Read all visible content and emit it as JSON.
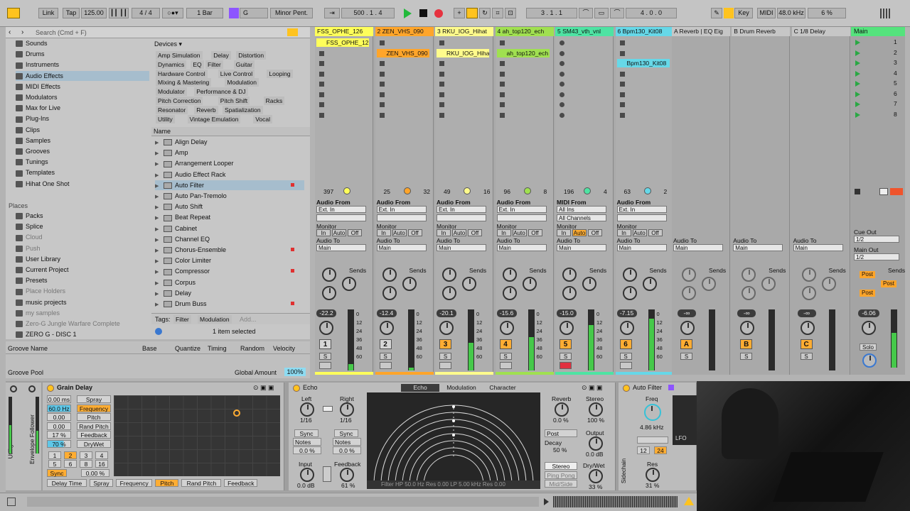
{
  "transport": {
    "link": "Link",
    "tap": "Tap",
    "tempo": "125.00",
    "sig_num": "4",
    "sig_den": "4",
    "quant": "1 Bar",
    "key_root": "G",
    "scale": "Minor Pent.",
    "arr_pos": "500 . 1 . 4",
    "punch_start": "3 . 1 . 1",
    "punch_len": "4 . 0 . 0",
    "key_label": "Key",
    "midi_label": "MIDI",
    "sample_rate": "48.0 kHz",
    "cpu": "6 %"
  },
  "browser": {
    "search_placeholder": "Search (Cmd + F)",
    "categories": [
      "Sounds",
      "Drums",
      "Instruments",
      "Audio Effects",
      "MIDI Effects",
      "Modulators",
      "Max for Live",
      "Plug-Ins",
      "Clips",
      "Samples",
      "Grooves",
      "Tunings",
      "Templates",
      "Hihat One Shot"
    ],
    "places_label": "Places",
    "places": [
      "Packs",
      "Splice",
      "Cloud",
      "Push",
      "User Library",
      "Current Project",
      "Presets",
      "Place Holders",
      "music projects",
      "my samples",
      "Zero-G Jungle Warfare Complete",
      "ZERO G - DISC 1"
    ],
    "devices_label": "Devices",
    "tags": [
      [
        "Amp Simulation",
        "Delay",
        "Distortion"
      ],
      [
        "Dynamics",
        "EQ",
        "Filter",
        "Guitar"
      ],
      [
        "Hardware Control",
        "Live Control",
        "Looping"
      ],
      [
        "Mixing & Mastering",
        "Modulation"
      ],
      [
        "Modulator",
        "Performance & DJ"
      ],
      [
        "Pitch Correction",
        "Pitch Shift",
        "Racks"
      ],
      [
        "Resonator",
        "Reverb",
        "Spatialization"
      ],
      [
        "Utility",
        "Vintage Emulation",
        "Vocal"
      ]
    ],
    "name_header": "Name",
    "items": [
      "Align Delay",
      "Amp",
      "Arrangement Looper",
      "Audio Effect Rack",
      "Auto Filter",
      "Auto Pan-Tremolo",
      "Auto Shift",
      "Beat Repeat",
      "Cabinet",
      "Channel EQ",
      "Chorus-Ensemble",
      "Color Limiter",
      "Compressor",
      "Corpus",
      "Delay",
      "Drum Buss"
    ],
    "tags_label": "Tags:",
    "tag_filter": "Filter",
    "tag_modulation": "Modulation",
    "tag_add": "Add...",
    "status": "1 item selected"
  },
  "groove": {
    "name": "Groove Name",
    "base": "Base",
    "quantize": "Quantize",
    "timing": "Timing",
    "random": "Random",
    "velocity": "Velocity",
    "pool": "Groove Pool",
    "global_amount_label": "Global Amount",
    "global_amount": "100%"
  },
  "tracks": [
    {
      "name": "FSS_OPHE_126",
      "color": "#ffff5a",
      "clip": "FSS_OPHE_126",
      "num": "1",
      "vol": "-22.2",
      "cpu": "397",
      "io": "Audio From",
      "src": "Ext. In"
    },
    {
      "name": "2 ZEN_VHS_090",
      "color": "#ffa52a",
      "clip": "ZEN_VHS_090",
      "num": "2",
      "vol": "-12.4",
      "cpu": "25",
      "cpu2": "32",
      "io": "Audio From",
      "src": "Ext. In"
    },
    {
      "name": "3 RKU_IOG_Hihat",
      "color": "#fffb8c",
      "clip": "RKU_IOG_Hiha",
      "num": "3",
      "vol": "-20.1",
      "cpu": "49",
      "cpu2": "16",
      "io": "Audio From",
      "src": "Ext. In"
    },
    {
      "name": "4 ah_top120_ech",
      "color": "#a0e050",
      "clip": "ah_top120_ech",
      "num": "4",
      "vol": "-15.6",
      "cpu": "96",
      "cpu2": "8",
      "io": "Audio From",
      "src": "Ext. In"
    },
    {
      "name": "5 SM43_vth_vnl",
      "color": "#4ee3a3",
      "clip": "",
      "num": "5",
      "vol": "-15.0",
      "cpu": "196",
      "cpu2": "4",
      "io": "MIDI From",
      "src": "All Ins",
      "src2": "All Channels"
    },
    {
      "name": "6 Bpm130_Kit08",
      "color": "#66d8e8",
      "clip": "Bpm130_Kit08",
      "num": "6",
      "vol": "-7.15",
      "cpu": "63",
      "cpu2": "2",
      "io": "Audio From",
      "src": "Ext. In"
    }
  ],
  "returns": [
    {
      "name": "A Reverb | EQ Eig",
      "letter": "A"
    },
    {
      "name": "B Drum Reverb",
      "letter": "B"
    },
    {
      "name": "C 1/8 Delay",
      "letter": "C"
    }
  ],
  "master": {
    "name": "Main",
    "scenes": [
      "1",
      "2",
      "3",
      "4",
      "5",
      "6",
      "7",
      "8"
    ],
    "cue_out": "Cue Out",
    "cue_val": "1/2",
    "main_out": "Main Out",
    "main_val": "1/2",
    "vol": "-6.06",
    "solo": "Solo"
  },
  "mixer_labels": {
    "monitor": "Monitor",
    "in": "In",
    "auto": "Auto",
    "off": "Off",
    "audio_to": "Audio To",
    "main": "Main",
    "sends": "Sends",
    "s": "S",
    "post": "Post",
    "neg_inf": "-∞"
  },
  "grain_delay": {
    "title": "Grain Delay",
    "params": [
      "0.00 ms",
      "60.0 Hz",
      "0.00",
      "0.00",
      "17 %",
      "70 %"
    ],
    "labels": [
      "Spray",
      "Frequency",
      "Pitch",
      "Rand Pitch",
      "Feedback",
      "DryWet"
    ],
    "grid": [
      "1",
      "2",
      "3",
      "4",
      "5",
      "6",
      "8",
      "16"
    ],
    "sync": "Sync",
    "sync_val": "0.00 %",
    "bottom": [
      "Delay Time",
      "Spray",
      "Frequency",
      "Pitch",
      "Rand Pitch",
      "Feedback"
    ],
    "side_labels": [
      "Utility",
      "Envelope Follower"
    ]
  },
  "echo": {
    "title": "Echo",
    "tabs": [
      "Echo",
      "Modulation",
      "Character"
    ],
    "left": "Left",
    "right": "Right",
    "left_val": "1/16",
    "right_val": "1/16",
    "sync": "Sync",
    "notes": "Notes",
    "pct": "0.0 %",
    "input": "Input",
    "input_val": "0.0 dB",
    "feedback": "Feedback",
    "feedback_val": "61 %",
    "reverb": "Reverb",
    "reverb_val": "0.0 %",
    "stereo": "Stereo",
    "stereo_val": "100 %",
    "post": "Post",
    "decay": "Decay",
    "decay_val": "50 %",
    "output": "Output",
    "output_val": "0.0 dB",
    "modes": [
      "Stereo",
      "Ping Pong",
      "Mid/Side"
    ],
    "drywet": "Dry/Wet",
    "drywet_val": "33 %",
    "filter_info": "Filter HP 50.0 Hz  Res 0.00  LP 5.00 kHz  Res 0.00"
  },
  "auto_filter": {
    "title": "Auto Filter",
    "freq": "Freq",
    "freq_val": "4.86 kHz",
    "slope_a": "12",
    "slope_b": "24",
    "lfo": "LFO",
    "res": "Res",
    "res_val": "31 %",
    "sidechain": "Sidechain"
  }
}
